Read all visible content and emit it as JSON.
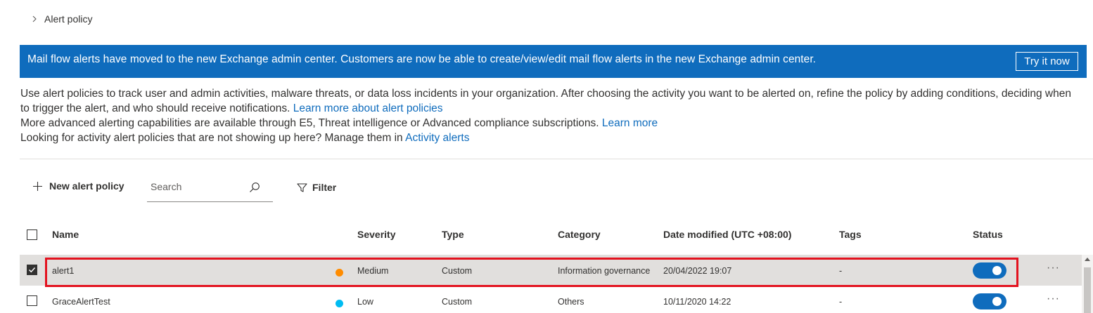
{
  "breadcrumb": {
    "current": "Alert policy"
  },
  "banner": {
    "message": "Mail flow alerts have moved to the new Exchange admin center. Customers are now be able to create/view/edit mail flow alerts in the new Exchange admin center.",
    "button_label": "Try it now",
    "color": "#0f6cbd"
  },
  "description": {
    "line1": "Use alert policies to track user and admin activities, malware threats, or data loss incidents in your organization. After choosing the activity you want to be alerted on, refine the policy by adding conditions, deciding when to trigger the alert, and who should receive notifications.",
    "link1": "Learn more about alert policies",
    "line2": "More advanced alerting capabilities are available through E5, Threat intelligence or Advanced compliance subscriptions.",
    "link2": "Learn more",
    "line3": "Looking for activity alert policies that are not showing up here? Manage them in",
    "link3": "Activity alerts"
  },
  "toolbar": {
    "new_label": "New alert policy",
    "search_placeholder": "Search",
    "filter_label": "Filter"
  },
  "table": {
    "headers": {
      "name": "Name",
      "severity": "Severity",
      "type": "Type",
      "category": "Category",
      "date": "Date modified (UTC +08:00)",
      "tags": "Tags",
      "status": "Status"
    },
    "rows": [
      {
        "name": "alert1",
        "severity": "Medium",
        "severity_color": "#ff8c00",
        "type": "Custom",
        "category": "Information governance",
        "date": "20/04/2022 19:07",
        "tags": "-",
        "status_on": true,
        "selected": true,
        "more": "···"
      },
      {
        "name": "GraceAlertTest",
        "severity": "Low",
        "severity_color": "#00bcf2",
        "type": "Custom",
        "category": "Others",
        "date": "10/11/2020 14:22",
        "tags": "-",
        "status_on": true,
        "selected": false,
        "more": "···"
      }
    ]
  },
  "highlight_color": "#e3121f"
}
